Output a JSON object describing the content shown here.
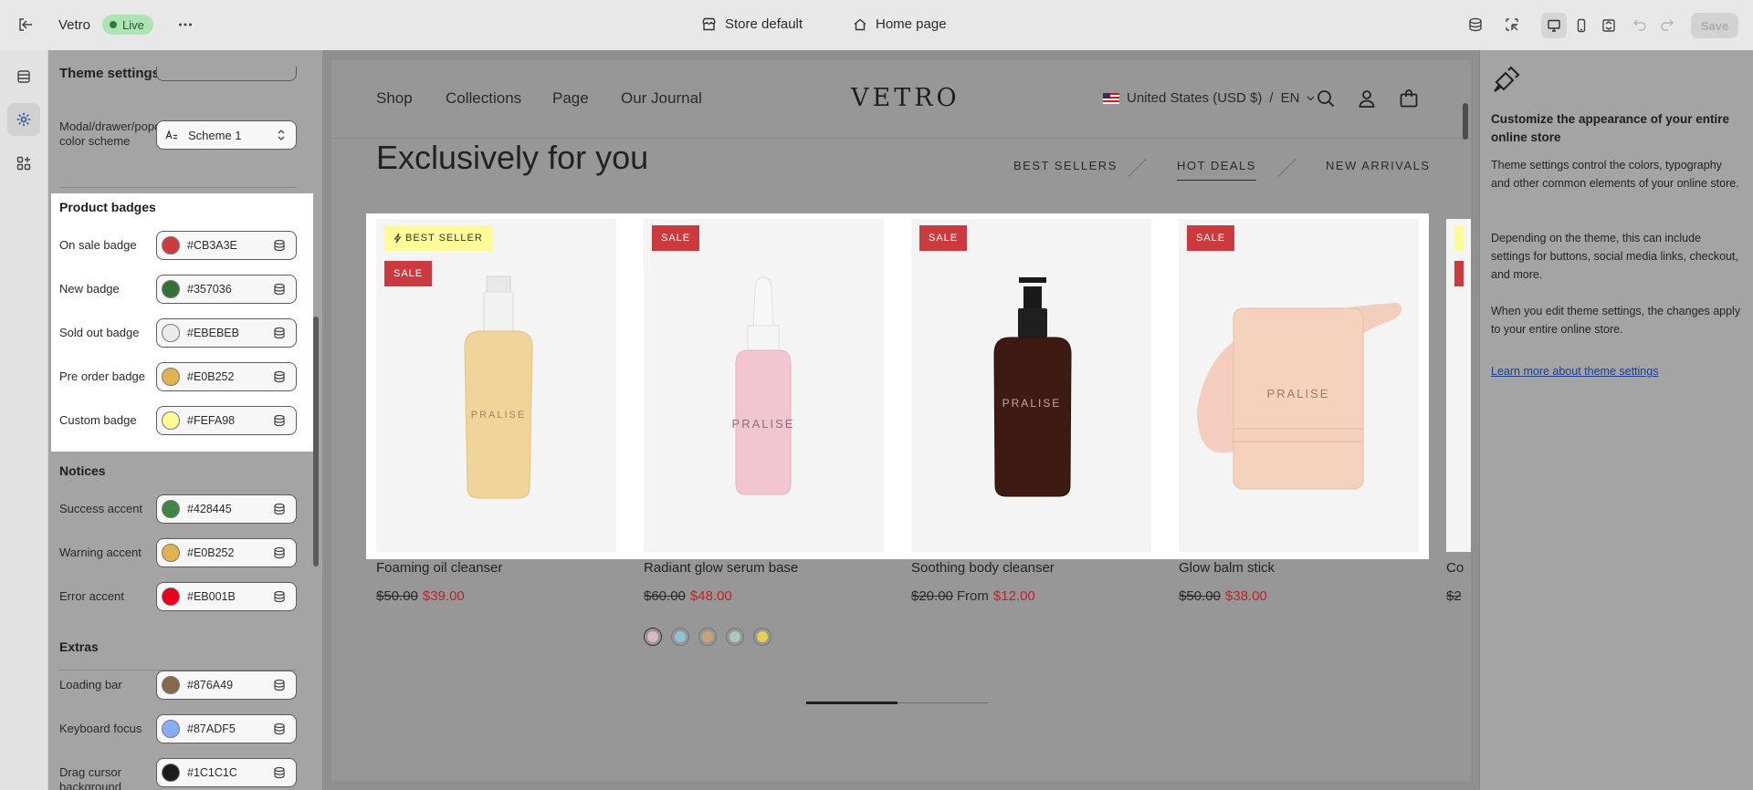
{
  "topbar": {
    "app_name": "Vetro",
    "status": "Live",
    "theme": "Store default",
    "page": "Home page",
    "save_label": "Save"
  },
  "panel": {
    "title": "Theme settings",
    "modal_row": {
      "label": "Modal/drawer/popover color scheme",
      "value": "Scheme 1"
    },
    "product_badges": {
      "heading": "Product badges",
      "rows": [
        {
          "label": "On sale badge",
          "hex": "#CB3A3E"
        },
        {
          "label": "New badge",
          "hex": "#357036"
        },
        {
          "label": "Sold out badge",
          "hex": "#EBEBEB"
        },
        {
          "label": "Pre order badge",
          "hex": "#E0B252"
        },
        {
          "label": "Custom badge",
          "hex": "#FEFA98"
        }
      ]
    },
    "notices": {
      "heading": "Notices",
      "rows": [
        {
          "label": "Success accent",
          "hex": "#428445"
        },
        {
          "label": "Warning accent",
          "hex": "#E0B252"
        },
        {
          "label": "Error accent",
          "hex": "#EB001B"
        }
      ]
    },
    "extras": {
      "heading": "Extras",
      "rows": [
        {
          "label": "Loading bar",
          "hex": "#876A49"
        },
        {
          "label": "Keyboard focus",
          "hex": "#87ADF5"
        },
        {
          "label": "Drag cursor background",
          "hex": "#1C1C1C"
        }
      ]
    }
  },
  "store": {
    "nav": [
      "Shop",
      "Collections",
      "Page",
      "Our Journal"
    ],
    "logo": "VETRO",
    "locale": "United States (USD $)",
    "lang": "EN",
    "section_title": "Exclusively for you",
    "tabs": [
      "BEST SELLERS",
      "HOT DEALS",
      "NEW ARRIVALS"
    ],
    "active_tab": "HOT DEALS",
    "products": [
      {
        "name": "Foaming oil cleanser",
        "old_price": "$50.00",
        "from": "",
        "price": "$39.00",
        "badges": [
          "BEST SELLER",
          "SALE"
        ],
        "brand": "PRALISE"
      },
      {
        "name": "Radiant glow serum base",
        "old_price": "$60.00",
        "from": "",
        "price": "$48.00",
        "badges": [
          "SALE"
        ],
        "brand": "PRALISE"
      },
      {
        "name": "Soothing body cleanser",
        "old_price": "$20.00",
        "from": "From",
        "price": "$12.00",
        "badges": [
          "SALE"
        ],
        "brand": "PRALISE"
      },
      {
        "name": "Glow balm stick",
        "old_price": "$50.00",
        "from": "",
        "price": "$38.00",
        "badges": [
          "SALE"
        ],
        "brand": "PRALISE"
      },
      {
        "name": "Co",
        "old_price": "$2",
        "from": "",
        "price": "",
        "badges": [],
        "brand": ""
      }
    ],
    "swatch_colors": [
      "#d9b8c4",
      "#8fc1d9",
      "#c9a07c",
      "#a8cbb3",
      "#e6cf55"
    ],
    "slider_progress": 0.5
  },
  "info": {
    "heading": "Customize the appearance of your entire online store",
    "p1": "Theme settings control the colors, typography and other common elements of your online store.",
    "p2": "Depending on the theme, this can include settings for buttons, social media links, checkout, and more.",
    "p3": "When you edit theme settings, the changes apply to your entire online store.",
    "link": "Learn more about theme settings"
  }
}
